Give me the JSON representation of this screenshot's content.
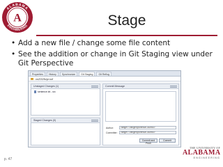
{
  "slide": {
    "title": "Stage",
    "bullets": [
      "Add a new file / change some file content",
      "See the addition or change in Git Staging view under Git Perspective"
    ],
    "page_number": "p. 47"
  },
  "logo": {
    "ring_text_top": "ALABAMA",
    "ring_text_bottom": "ENGINEERING",
    "accent_color": "#9e1b32"
  },
  "footer_logo": {
    "line1": "THE UNIVERSITY OF",
    "line2": "ALABAMA",
    "line3": "ENGINEERING"
  },
  "ide": {
    "tabs": [
      "Properties",
      "History",
      "Synchronize",
      "Git Staging",
      "Git Reflog"
    ],
    "active_tab": 3,
    "repo_path": "cs200/fs/proof",
    "unstaged_header": "Unstaged Changes (1)",
    "unstaged_files": [
      "sentence.txt - src"
    ],
    "staged_header": "Staged Changes (0)",
    "commit_header": "Commit Message",
    "author_label": "Author:",
    "author_value": "Vanger <Vanger@crimson.ua.edu>",
    "committer_label": "Committer:",
    "committer_value": "Vanger <Vanger@crimson.ua.edu>",
    "commit_push_label": "Commit and Push",
    "commit_label": "Commit"
  }
}
